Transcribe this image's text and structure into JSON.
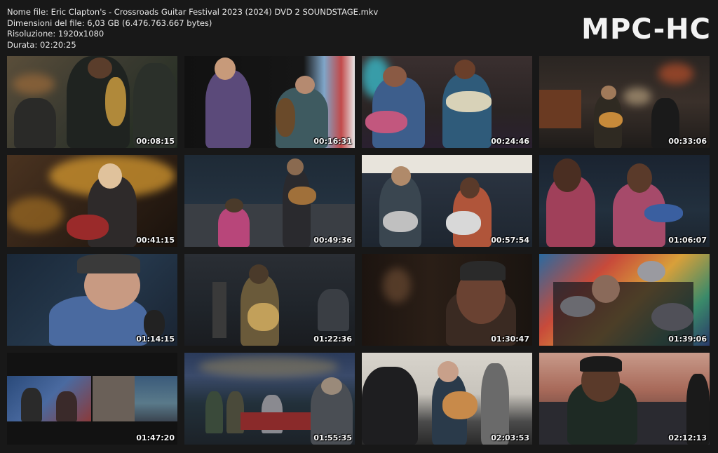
{
  "header": {
    "file_name_line": "Nome file: Eric Clapton's - Crossroads Guitar Festival 2023 (2024) DVD 2 SOUNDSTAGE.mkv",
    "file_size_line": "Dimensioni del file: 6,03 GB (6.476.763.667 bytes)",
    "resolution_line": "Risoluzione: 1920x1080",
    "duration_line": "Durata: 02:20:25"
  },
  "logo": "MPC-HC",
  "colors": {
    "background": "#181818",
    "text": "#e8e8e8"
  },
  "thumbnails": [
    {
      "timestamp": "00:08:15"
    },
    {
      "timestamp": "00:16:31"
    },
    {
      "timestamp": "00:24:46"
    },
    {
      "timestamp": "00:33:06"
    },
    {
      "timestamp": "00:41:15"
    },
    {
      "timestamp": "00:49:36"
    },
    {
      "timestamp": "00:57:54"
    },
    {
      "timestamp": "01:06:07"
    },
    {
      "timestamp": "01:14:15"
    },
    {
      "timestamp": "01:22:36"
    },
    {
      "timestamp": "01:30:47"
    },
    {
      "timestamp": "01:39:06"
    },
    {
      "timestamp": "01:47:20"
    },
    {
      "timestamp": "01:55:35"
    },
    {
      "timestamp": "02:03:53"
    },
    {
      "timestamp": "02:12:13"
    }
  ]
}
